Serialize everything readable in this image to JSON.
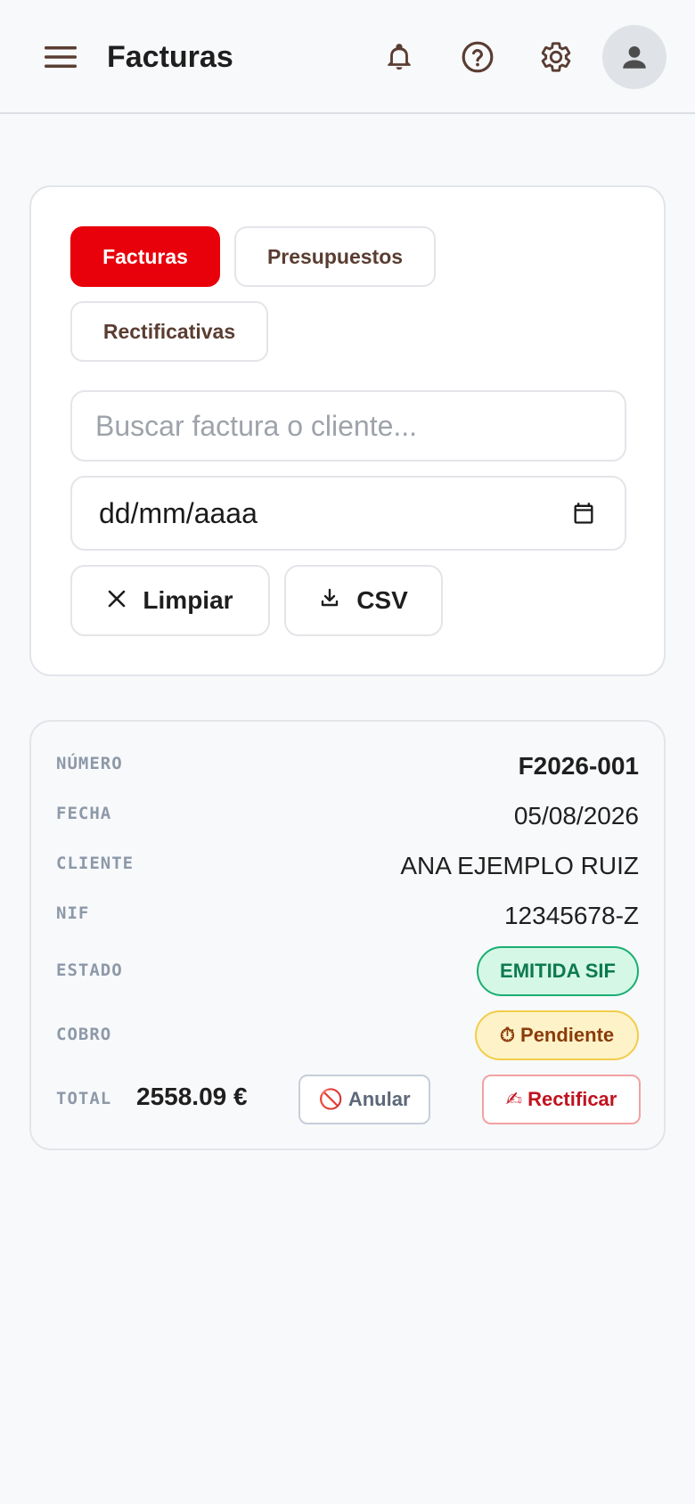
{
  "header": {
    "title": "Facturas",
    "menu_icon": "hamburger-menu-icon",
    "icons": [
      "bell-icon",
      "help-circle-icon",
      "gear-icon",
      "user-avatar-icon"
    ]
  },
  "filters": {
    "tabs": [
      {
        "label": "Facturas",
        "active": true
      },
      {
        "label": "Presupuestos",
        "active": false
      },
      {
        "label": "Rectificativas",
        "active": false
      }
    ],
    "search": {
      "placeholder": "Buscar factura o cliente...",
      "value": ""
    },
    "date": {
      "display": "dd/mm/aaaa"
    },
    "clear_label": "Limpiar",
    "csv_label": "CSV"
  },
  "invoice": {
    "numero_label": "NÚMERO",
    "numero": "F2026-001",
    "fecha_label": "FECHA",
    "fecha": "05/08/2026",
    "cliente_label": "CLIENTE",
    "cliente": "ANA EJEMPLO RUIZ",
    "nif_label": "NIF",
    "nif": "12345678-Z",
    "estado_label": "ESTADO",
    "estado": "EMITIDA SIF",
    "cobro_label": "COBRO",
    "cobro_icon": "⏱",
    "cobro": "Pendiente",
    "total_label": "TOTAL",
    "total": "2558.09 €",
    "anular_icon": "🚫",
    "anular_label": "Anular",
    "rectificar_icon": "✍",
    "rectificar_label": "Rectificar"
  },
  "colors": {
    "accent": "#e8000b",
    "tab_text": "#5a3d32",
    "estado_green": "#1aae72",
    "cobro_yellow": "#f2cd4b",
    "rectificar_red": "#c1121f"
  }
}
